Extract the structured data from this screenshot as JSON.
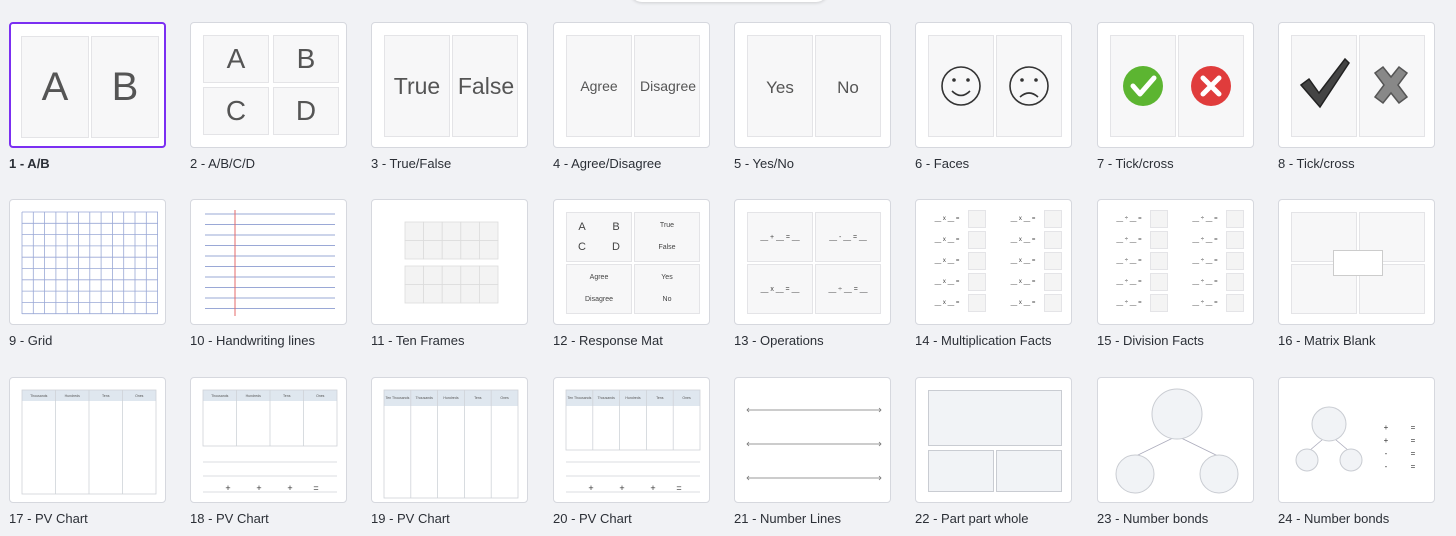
{
  "templates": [
    {
      "label": "1 - A/B",
      "texts": [
        "A",
        "B"
      ]
    },
    {
      "label": "2 - A/B/C/D",
      "texts": [
        "A",
        "B",
        "C",
        "D"
      ]
    },
    {
      "label": "3 - True/False",
      "texts": [
        "True",
        "False"
      ]
    },
    {
      "label": "4 - Agree/Disagree",
      "texts": [
        "Agree",
        "Disagree"
      ]
    },
    {
      "label": "5 - Yes/No",
      "texts": [
        "Yes",
        "No"
      ]
    },
    {
      "label": "6 - Faces"
    },
    {
      "label": "7 - Tick/cross"
    },
    {
      "label": "8 - Tick/cross"
    },
    {
      "label": "9 - Grid"
    },
    {
      "label": "10 - Handwriting lines"
    },
    {
      "label": "11 - Ten Frames"
    },
    {
      "label": "12 - Response Mat",
      "texts": [
        "A",
        "B",
        "C",
        "D",
        "True",
        "False",
        "Agree",
        "Yes",
        "Disagree",
        "No"
      ]
    },
    {
      "label": "13 - Operations",
      "texts": [
        "__ + __ = __",
        "__ - __ = __",
        "__ x __ = __",
        "__ ÷ __ = __"
      ]
    },
    {
      "label": "14 - Multiplication Facts",
      "texts": [
        "__ x __ ="
      ]
    },
    {
      "label": "15 - Division Facts",
      "texts": [
        "__ ÷ __ ="
      ]
    },
    {
      "label": "16 - Matrix Blank"
    },
    {
      "label": "17 - PV Chart",
      "texts": [
        "Thousands",
        "Hundreds",
        "Tens",
        "Ones"
      ]
    },
    {
      "label": "18 - PV Chart",
      "texts": [
        "Thousands",
        "Hundreds",
        "Tens",
        "Ones",
        "+",
        "+",
        "+",
        "="
      ]
    },
    {
      "label": "19 - PV Chart",
      "texts": [
        "Ten Thousands",
        "Thousands",
        "Hundreds",
        "Tens",
        "Ones"
      ]
    },
    {
      "label": "20 - PV Chart",
      "texts": [
        "Ten Thousands",
        "Thousands",
        "Hundreds",
        "Tens",
        "Ones",
        "+",
        "+",
        "+",
        "="
      ]
    },
    {
      "label": "21 - Number Lines"
    },
    {
      "label": "22 - Part part whole"
    },
    {
      "label": "23 - Number bonds"
    },
    {
      "label": "24 - Number bonds",
      "texts": [
        "+",
        "=",
        "+",
        "=",
        "-",
        "=",
        "-",
        "="
      ]
    }
  ],
  "selected_index": 0,
  "colors": {
    "selected_border": "#7b2ff2",
    "tick_green": "#5cb531",
    "cross_red": "#e03c3c",
    "grid_blue": "#9aa8d6",
    "margin_red": "#e46a6a",
    "pv_header": "#dfe7ef"
  }
}
